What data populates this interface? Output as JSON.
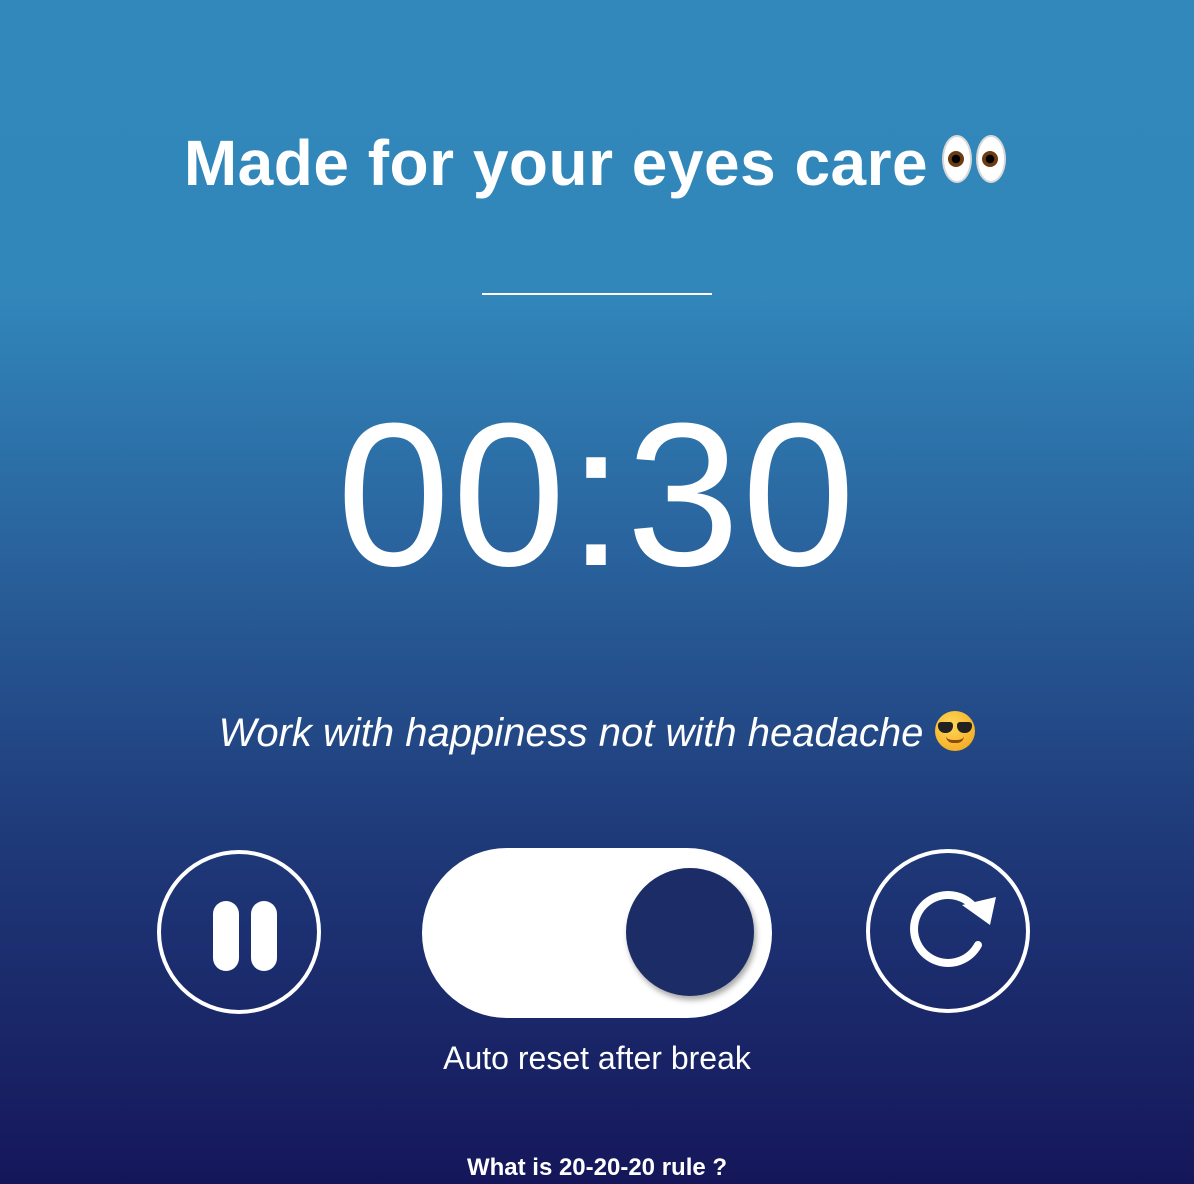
{
  "header": {
    "title": "Made for your eyes care",
    "title_icon": "eyes-emoji"
  },
  "timer": {
    "display": "00:30"
  },
  "tagline": {
    "text": "Work with happiness not with headache",
    "icon": "sunglasses-emoji"
  },
  "controls": {
    "pause_icon": "pause-icon",
    "reset_icon": "refresh-icon",
    "auto_reset_toggle": {
      "on": true,
      "label": "Auto reset after break"
    }
  },
  "footer": {
    "link_text": "What is 20-20-20 rule ?"
  },
  "colors": {
    "gradient_top": "#3288bb",
    "gradient_bottom": "#15165a",
    "toggle_knob": "#1c2c66",
    "text": "#ffffff"
  }
}
